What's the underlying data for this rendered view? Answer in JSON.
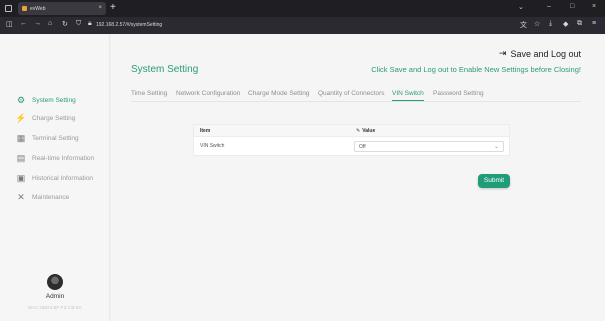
{
  "browser": {
    "tab_title": "evWeb",
    "tab_close": "×",
    "new_tab": "+",
    "url": "192.168.2.57/#/systemSetting",
    "window_controls": [
      "⌄",
      "–",
      "□",
      "×"
    ],
    "nav_icons": [
      "sidebar-icon",
      "back-icon",
      "forward-icon",
      "home-icon",
      "reload-icon",
      "shield-icon",
      "lock-icon"
    ]
  },
  "sidebar": {
    "items": [
      {
        "label": "System Setting",
        "icon": "gear-icon",
        "active": true
      },
      {
        "label": "Charge Setting",
        "icon": "plug-icon",
        "active": false
      },
      {
        "label": "Terminal Setting",
        "icon": "terminal-icon",
        "active": false
      },
      {
        "label": "Real-time Information",
        "icon": "chart-icon",
        "active": false
      },
      {
        "label": "Historical Information",
        "icon": "history-icon",
        "active": false
      },
      {
        "label": "Maintenance",
        "icon": "tools-icon",
        "active": false
      }
    ],
    "user": "Admin",
    "mac": "MAC:0BD4:8F:F3:CB:5A"
  },
  "header": {
    "save_logout": "Save and Log out",
    "title": "System Setting",
    "hint": "Click Save and Log out to Enable New Settings before Closing!"
  },
  "tabs": [
    {
      "label": "Time Setting",
      "active": false
    },
    {
      "label": "Network Configuration",
      "active": false
    },
    {
      "label": "Charge Mode Setting",
      "active": false
    },
    {
      "label": "Quantity of Connectors",
      "active": false
    },
    {
      "label": "VIN Switch",
      "active": true
    },
    {
      "label": "Password Setting",
      "active": false
    }
  ],
  "table": {
    "col_item": "Item",
    "col_value": "Value",
    "rows": [
      {
        "item": "VIN Switch",
        "value": "Off"
      }
    ]
  },
  "submit_label": "Submit",
  "colors": {
    "accent": "#2a9b77",
    "button": "#1f9c78"
  }
}
